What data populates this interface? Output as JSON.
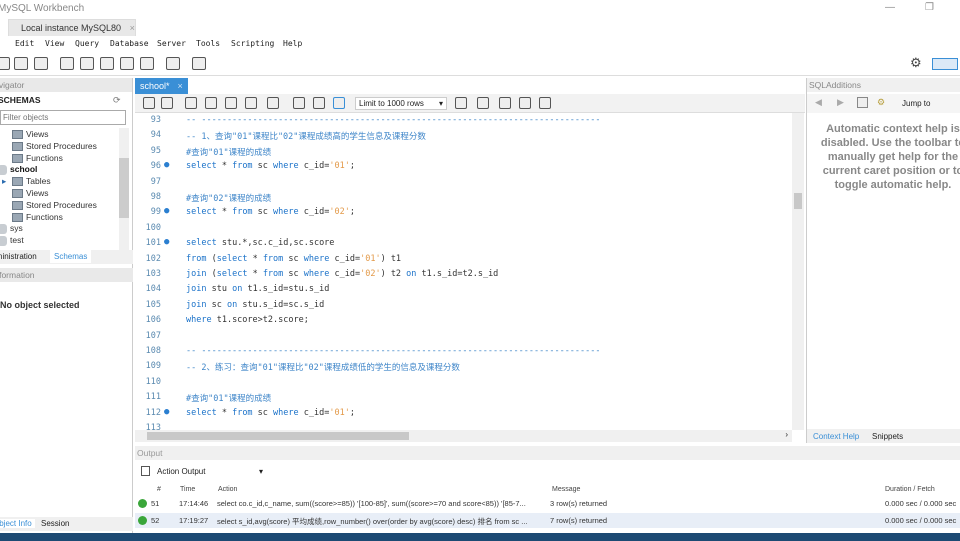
{
  "window": {
    "title": "MySQL Workbench",
    "connection_tab": "Local instance MySQL80",
    "close": "×"
  },
  "menu": [
    "Edit",
    "View",
    "Query",
    "Database",
    "Server",
    "Tools",
    "Scripting",
    "Help"
  ],
  "navigator": {
    "header": "Navigator",
    "schemas_label": "SCHEMAS",
    "filter_placeholder": "Filter objects",
    "tree": [
      {
        "label": "Views",
        "type": "folder",
        "indent": 1
      },
      {
        "label": "Stored Procedures",
        "type": "folder",
        "indent": 1
      },
      {
        "label": "Functions",
        "type": "folder",
        "indent": 1
      },
      {
        "label": "school",
        "type": "db",
        "indent": 0,
        "bold": true
      },
      {
        "label": "Tables",
        "type": "folder",
        "indent": 1,
        "arrow": true
      },
      {
        "label": "Views",
        "type": "folder",
        "indent": 1
      },
      {
        "label": "Stored Procedures",
        "type": "folder",
        "indent": 1
      },
      {
        "label": "Functions",
        "type": "folder",
        "indent": 1
      },
      {
        "label": "sys",
        "type": "db",
        "indent": 0
      },
      {
        "label": "test",
        "type": "db",
        "indent": 0
      }
    ],
    "tabs": [
      "Administration",
      "Schemas"
    ],
    "info_header": "Information",
    "no_object": "No object selected",
    "bottom_tabs": [
      "Object Info",
      "Session"
    ]
  },
  "editor": {
    "tab": "school*",
    "limit": "Limit to 1000 rows",
    "lines": [
      {
        "n": "93",
        "m": "",
        "t": [
          [
            "cm",
            "-- ------------------------------------------------------------------------------"
          ]
        ]
      },
      {
        "n": "94",
        "m": "",
        "t": [
          [
            "cm",
            "-- 1、查询\"01\"课程比\"02\"课程成绩高的学生信息及课程分数"
          ]
        ]
      },
      {
        "n": "95",
        "m": "",
        "t": [
          [
            "cm",
            "#查询\"01\"课程的成绩"
          ]
        ]
      },
      {
        "n": "96",
        "m": "●",
        "t": [
          [
            "kw",
            "select"
          ],
          [
            "id",
            " * "
          ],
          [
            "kw",
            "from"
          ],
          [
            "id",
            " sc "
          ],
          [
            "kw",
            "where"
          ],
          [
            "id",
            " c_id="
          ],
          [
            "str",
            "'01'"
          ],
          [
            "id",
            ";"
          ]
        ]
      },
      {
        "n": "97",
        "m": "",
        "t": []
      },
      {
        "n": "98",
        "m": "",
        "t": [
          [
            "cm",
            "#查询\"02\"课程的成绩"
          ]
        ]
      },
      {
        "n": "99",
        "m": "●",
        "t": [
          [
            "kw",
            "select"
          ],
          [
            "id",
            " * "
          ],
          [
            "kw",
            "from"
          ],
          [
            "id",
            " sc "
          ],
          [
            "kw",
            "where"
          ],
          [
            "id",
            " c_id="
          ],
          [
            "str",
            "'02'"
          ],
          [
            "id",
            ";"
          ]
        ]
      },
      {
        "n": "100",
        "m": "",
        "t": []
      },
      {
        "n": "101",
        "m": "●",
        "t": [
          [
            "kw",
            "select"
          ],
          [
            "id",
            " stu.*,sc.c_id,sc.score"
          ]
        ]
      },
      {
        "n": "102",
        "m": "",
        "t": [
          [
            "kw",
            "from"
          ],
          [
            "id",
            " ("
          ],
          [
            "kw",
            "select"
          ],
          [
            "id",
            " * "
          ],
          [
            "kw",
            "from"
          ],
          [
            "id",
            " sc "
          ],
          [
            "kw",
            "where"
          ],
          [
            "id",
            " c_id="
          ],
          [
            "str",
            "'01'"
          ],
          [
            "id",
            ") t1"
          ]
        ]
      },
      {
        "n": "103",
        "m": "",
        "t": [
          [
            "kw",
            "join"
          ],
          [
            "id",
            " ("
          ],
          [
            "kw",
            "select"
          ],
          [
            "id",
            " * "
          ],
          [
            "kw",
            "from"
          ],
          [
            "id",
            " sc "
          ],
          [
            "kw",
            "where"
          ],
          [
            "id",
            " c_id="
          ],
          [
            "str",
            "'02'"
          ],
          [
            "id",
            ") t2 "
          ],
          [
            "kw",
            "on"
          ],
          [
            "id",
            " t1.s_id=t2.s_id"
          ]
        ]
      },
      {
        "n": "104",
        "m": "",
        "t": [
          [
            "kw",
            "join"
          ],
          [
            "id",
            " stu "
          ],
          [
            "kw",
            "on"
          ],
          [
            "id",
            " t1.s_id=stu.s_id"
          ]
        ]
      },
      {
        "n": "105",
        "m": "",
        "t": [
          [
            "kw",
            "join"
          ],
          [
            "id",
            " sc "
          ],
          [
            "kw",
            "on"
          ],
          [
            "id",
            " stu.s_id=sc.s_id"
          ]
        ]
      },
      {
        "n": "106",
        "m": "",
        "t": [
          [
            "kw",
            "where"
          ],
          [
            "id",
            " t1.score>t2.score;"
          ]
        ]
      },
      {
        "n": "107",
        "m": "",
        "t": []
      },
      {
        "n": "108",
        "m": "",
        "t": [
          [
            "cm",
            "-- ------------------------------------------------------------------------------"
          ]
        ]
      },
      {
        "n": "109",
        "m": "",
        "t": [
          [
            "cm",
            "-- 2、练习：查询\"01\"课程比\"02\"课程成绩低的学生的信息及课程分数"
          ]
        ]
      },
      {
        "n": "110",
        "m": "",
        "t": []
      },
      {
        "n": "111",
        "m": "",
        "t": [
          [
            "cm",
            "#查询\"01\"课程的成绩"
          ]
        ]
      },
      {
        "n": "112",
        "m": "●",
        "t": [
          [
            "kw",
            "select"
          ],
          [
            "id",
            " * "
          ],
          [
            "kw",
            "from"
          ],
          [
            "id",
            " sc "
          ],
          [
            "kw",
            "where"
          ],
          [
            "id",
            " c_id="
          ],
          [
            "str",
            "'01'"
          ],
          [
            "id",
            ";"
          ]
        ]
      },
      {
        "n": "113",
        "m": "",
        "t": []
      }
    ]
  },
  "sql_additions": {
    "header": "SQLAdditions",
    "jump_to": "Jump to",
    "help_text": "Automatic context help is disabled. Use the toolbar to manually get help for the current caret position or to toggle automatic help.",
    "tabs": [
      "Context Help",
      "Snippets"
    ]
  },
  "output": {
    "header": "Output",
    "selector": "Action Output",
    "columns": [
      "#",
      "Time",
      "Action",
      "Message",
      "Duration / Fetch"
    ],
    "rows": [
      {
        "num": "51",
        "time": "17:14:46",
        "action": "select co.c_id,c_name, sum((score>=85)) '[100-85]',    sum((score>=70 and score<85)) '[85-7...",
        "message": "3 row(s) returned",
        "duration": "0.000 sec / 0.000 sec"
      },
      {
        "num": "52",
        "time": "17:19:27",
        "action": "select s_id,avg(score) 平均成绩,row_number() over(order by avg(score) desc) 排名 from sc ...",
        "message": "7 row(s) returned",
        "duration": "0.000 sec / 0.000 sec"
      }
    ]
  }
}
